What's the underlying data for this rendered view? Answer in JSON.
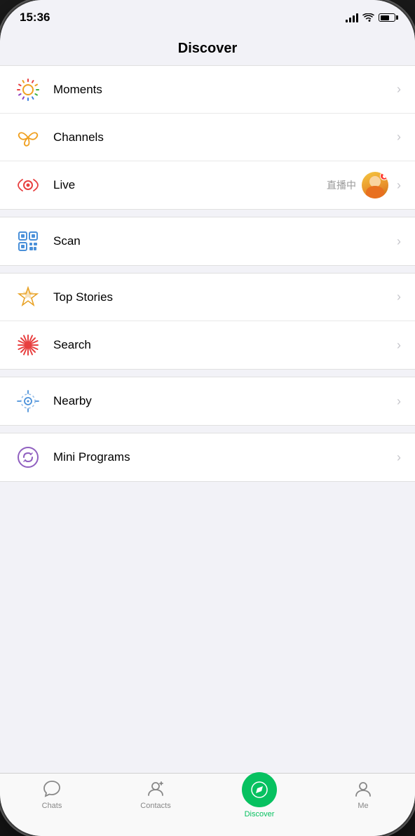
{
  "statusBar": {
    "time": "15:36"
  },
  "pageTitle": "Discover",
  "menuSections": [
    {
      "id": "section1",
      "items": [
        {
          "id": "moments",
          "label": "Moments",
          "icon": "moments"
        },
        {
          "id": "channels",
          "label": "Channels",
          "icon": "channels"
        },
        {
          "id": "live",
          "label": "Live",
          "icon": "live",
          "badge": "直播中",
          "hasAvatar": true
        }
      ]
    },
    {
      "id": "section2",
      "items": [
        {
          "id": "scan",
          "label": "Scan",
          "icon": "scan"
        }
      ]
    },
    {
      "id": "section3",
      "items": [
        {
          "id": "topstories",
          "label": "Top Stories",
          "icon": "topstories"
        },
        {
          "id": "search",
          "label": "Search",
          "icon": "search"
        }
      ]
    },
    {
      "id": "section4",
      "items": [
        {
          "id": "nearby",
          "label": "Nearby",
          "icon": "nearby"
        }
      ]
    },
    {
      "id": "section5",
      "items": [
        {
          "id": "miniprograms",
          "label": "Mini Programs",
          "icon": "miniprograms"
        }
      ]
    }
  ],
  "bottomNav": {
    "items": [
      {
        "id": "chats",
        "label": "Chats",
        "icon": "chat",
        "active": false
      },
      {
        "id": "contacts",
        "label": "Contacts",
        "icon": "contacts",
        "active": false
      },
      {
        "id": "discover",
        "label": "Discover",
        "icon": "compass",
        "active": true
      },
      {
        "id": "me",
        "label": "Me",
        "icon": "person",
        "active": false
      }
    ]
  }
}
